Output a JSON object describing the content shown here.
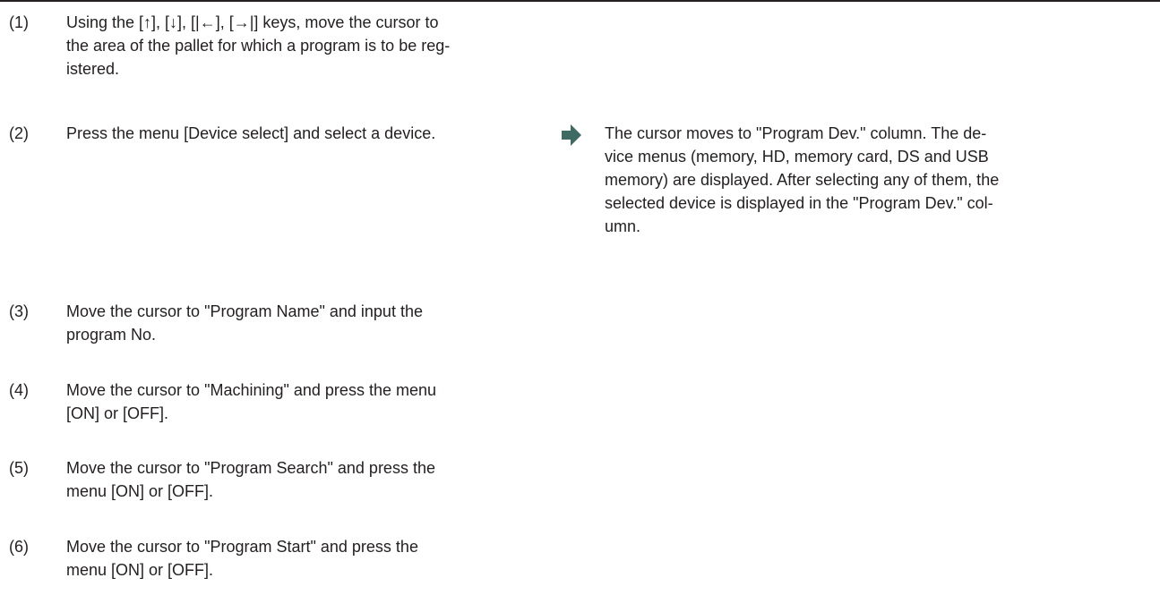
{
  "steps": [
    {
      "num": "(1)",
      "lines": [
        "Using the [↑], [↓], [|←], [→|] keys, move the cursor to",
        "the area of the pallet for which a program is to be reg-",
        "istered."
      ]
    },
    {
      "num": "(2)",
      "lines": [
        "Press the menu [Device select] and select a device."
      ],
      "result_lines": [
        "The cursor moves to \"Program Dev.\" column. The de-",
        "vice menus (memory, HD, memory card, DS and USB",
        "memory) are displayed. After selecting any of them, the",
        "selected device is displayed in the \"Program Dev.\" col-",
        "umn."
      ]
    },
    {
      "num": "(3)",
      "lines": [
        "Move the cursor to \"Program Name\" and input the",
        "program No."
      ]
    },
    {
      "num": "(4)",
      "lines": [
        "Move the cursor to \"Machining\" and press the menu",
        "[ON] or [OFF]."
      ]
    },
    {
      "num": "(5)",
      "lines": [
        "Move the cursor to \"Program Search\" and press the",
        "menu [ON] or [OFF]."
      ]
    },
    {
      "num": "(6)",
      "lines": [
        "Move the cursor to \"Program Start\" and press the",
        "menu [ON] or [OFF]."
      ]
    }
  ],
  "colors": {
    "text": "#231f20",
    "arrow": "#3d6b63"
  },
  "icons": {
    "result_arrow": "right-arrow-icon"
  }
}
